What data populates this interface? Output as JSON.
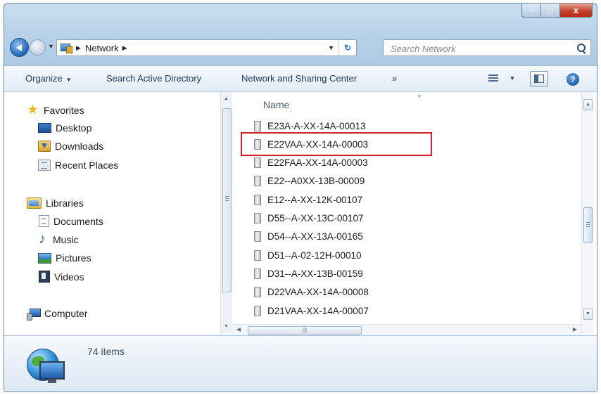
{
  "window": {
    "controls": {
      "minimize": "–",
      "maximize": "□",
      "close": "x"
    }
  },
  "address_bar": {
    "crumbs": [
      "Network"
    ],
    "search_placeholder": "Search Network"
  },
  "toolbar": {
    "organize": "Organize",
    "search_ad": "Search Active Directory",
    "network_sharing": "Network and Sharing Center",
    "more": "»",
    "help": "?"
  },
  "nav": {
    "favorites": {
      "label": "Favorites",
      "items": [
        "Desktop",
        "Downloads",
        "Recent Places"
      ]
    },
    "libraries": {
      "label": "Libraries",
      "items": [
        "Documents",
        "Music",
        "Pictures",
        "Videos"
      ]
    },
    "computer": "Computer"
  },
  "content": {
    "column_header": "Name",
    "files": [
      "E23A-A-XX-14A-00013",
      "E22VAA-XX-14A-00003",
      "E22FAA-XX-14A-00003",
      "E22--A0XX-13B-00009",
      "E12--A-XX-12K-00107",
      "D55--A-XX-13C-00107",
      "D54--A-XX-13A-00165",
      "D51--A-02-12H-00010",
      "D31--A-XX-13B-00159",
      "D22VAA-XX-14A-00008",
      "D21VAA-XX-14A-00007"
    ],
    "highlighted_index": 1,
    "highlight_color": "#d3202a"
  },
  "details": {
    "item_count": "74 items"
  }
}
